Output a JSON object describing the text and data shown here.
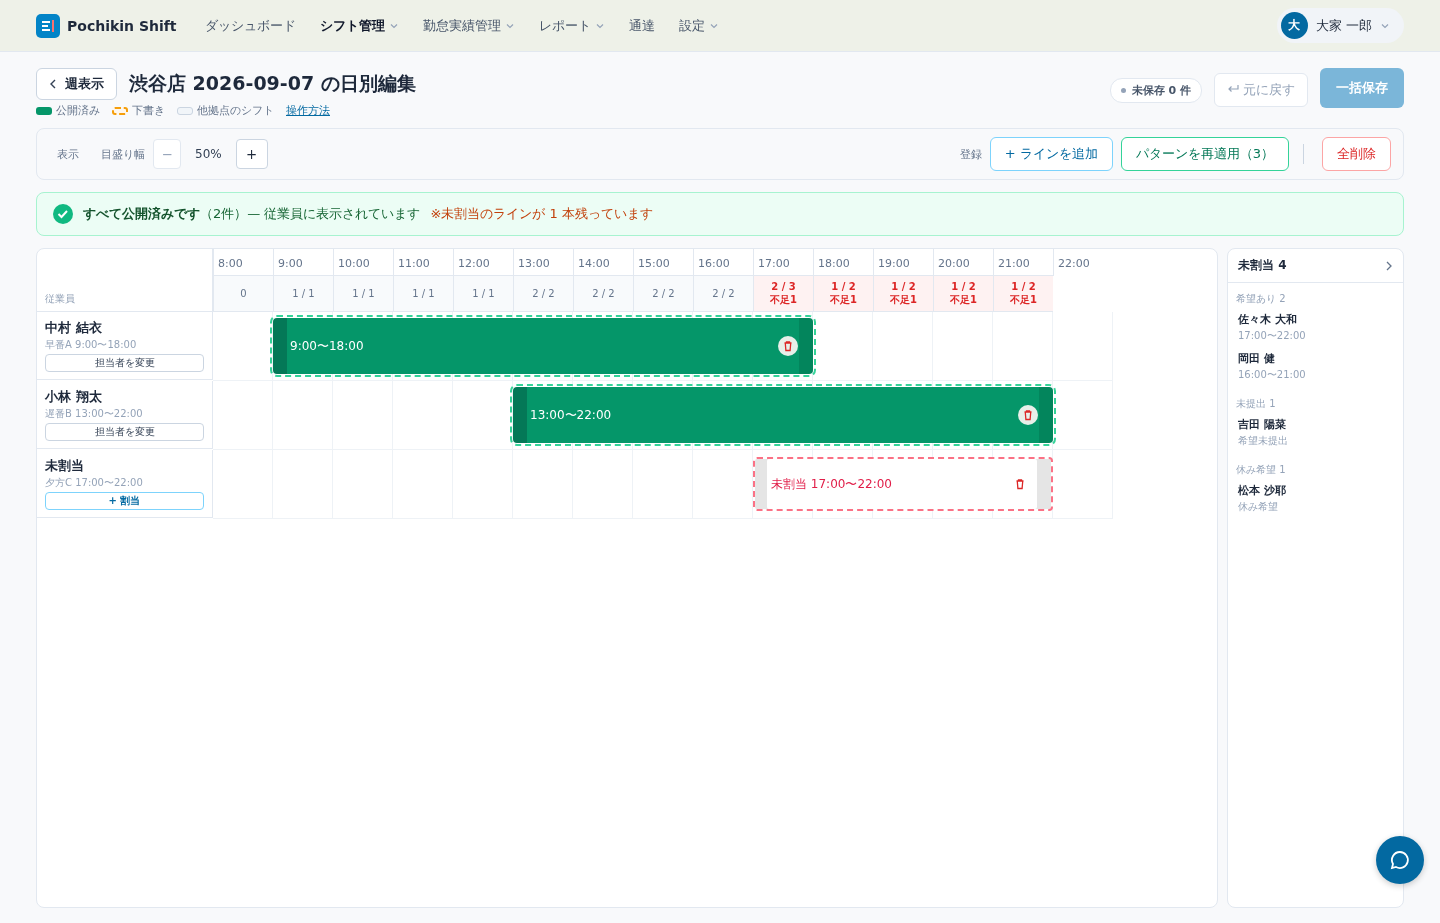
{
  "nav": {
    "brand": "Pochikin Shift",
    "items": [
      {
        "label": "ダッシュボード",
        "selected": false,
        "dropdown": false
      },
      {
        "label": "シフト管理",
        "selected": true,
        "dropdown": true
      },
      {
        "label": "勤怠実績管理",
        "selected": false,
        "dropdown": true
      },
      {
        "label": "レポート",
        "selected": false,
        "dropdown": true
      },
      {
        "label": "通達",
        "selected": false,
        "dropdown": false
      },
      {
        "label": "設定",
        "selected": false,
        "dropdown": true
      }
    ],
    "user": {
      "initial": "大",
      "name": "大家 一郎"
    }
  },
  "header": {
    "back": "週表示",
    "title": "渋谷店 2026-09-07 の日別編集",
    "unsaved": "未保存 0 件",
    "undo": "元に戻す",
    "save": "一括保存",
    "legend": [
      {
        "kind": "published",
        "label": "公開済み"
      },
      {
        "kind": "draft",
        "label": "下書き"
      },
      {
        "kind": "other",
        "label": "他拠点のシフト"
      }
    ],
    "help": "操作方法"
  },
  "toolbar": {
    "display": "表示",
    "scale_label": "目盛り幅",
    "minus": "−",
    "scale": "50%",
    "plus": "+",
    "register": "登録",
    "add": "+ ラインを追加",
    "reapply": "パターンを再適用（3）",
    "delete_all": "全削除"
  },
  "banner": {
    "strong": "すべて公開済みです",
    "rest": "（2件）— 従業員に表示されています",
    "warning": "※未割当のラインが 1 本残っています"
  },
  "timeline": {
    "employee_heading": "従業員",
    "hours": [
      "8:00",
      "9:00",
      "10:00",
      "11:00",
      "12:00",
      "13:00",
      "14:00",
      "15:00",
      "16:00",
      "17:00",
      "18:00",
      "19:00",
      "20:00",
      "21:00",
      "22:00"
    ],
    "counts": [
      {
        "value": "0",
        "short": false
      },
      {
        "value": "1 / 1",
        "short": false
      },
      {
        "value": "1 / 1",
        "short": false
      },
      {
        "value": "1 / 1",
        "short": false
      },
      {
        "value": "1 / 1",
        "short": false
      },
      {
        "value": "2 / 2",
        "short": false
      },
      {
        "value": "2 / 2",
        "short": false
      },
      {
        "value": "2 / 2",
        "short": false
      },
      {
        "value": "2 / 2",
        "short": false
      },
      {
        "value": "2 / 3",
        "short": true,
        "note": "不足1"
      },
      {
        "value": "1 / 2",
        "short": true,
        "note": "不足1"
      },
      {
        "value": "1 / 2",
        "short": true,
        "note": "不足1"
      },
      {
        "value": "1 / 2",
        "short": true,
        "note": "不足1"
      },
      {
        "value": "1 / 2",
        "short": true,
        "note": "不足1"
      }
    ],
    "rows": [
      {
        "name": "中村 結衣",
        "sub": "早番A 9:00〜18:00",
        "action": {
          "kind": "change",
          "label": "担当者を変更"
        },
        "bar": {
          "kind": "published",
          "start": "9:00",
          "sep": "〜",
          "end": "18:00"
        }
      },
      {
        "name": "小林 翔太",
        "sub": "遅番B 13:00〜22:00",
        "action": {
          "kind": "change",
          "label": "担当者を変更"
        },
        "bar": {
          "kind": "published",
          "start": "13:00",
          "sep": "〜",
          "end": "22:00"
        }
      },
      {
        "name": "未割当",
        "sub": "夕方C 17:00〜22:00",
        "action": {
          "kind": "assign",
          "label": "+ 割当"
        },
        "bar": {
          "kind": "unassigned",
          "prefix": "未割当",
          "start": "17:00",
          "sep": "〜",
          "end": "22:00"
        }
      }
    ]
  },
  "side": {
    "title": "未割当 4",
    "groups": [
      {
        "label": "希望あり 2",
        "people": [
          {
            "name": "佐々木 大和",
            "sub": "17:00〜22:00"
          },
          {
            "name": "岡田 健",
            "sub": "16:00〜21:00"
          }
        ]
      },
      {
        "label": "未提出 1",
        "people": [
          {
            "name": "吉田 陽菜",
            "sub": "希望未提出"
          }
        ]
      },
      {
        "label": "休み希望 1",
        "people": [
          {
            "name": "松本 沙耶",
            "sub": "休み希望"
          }
        ]
      }
    ]
  }
}
